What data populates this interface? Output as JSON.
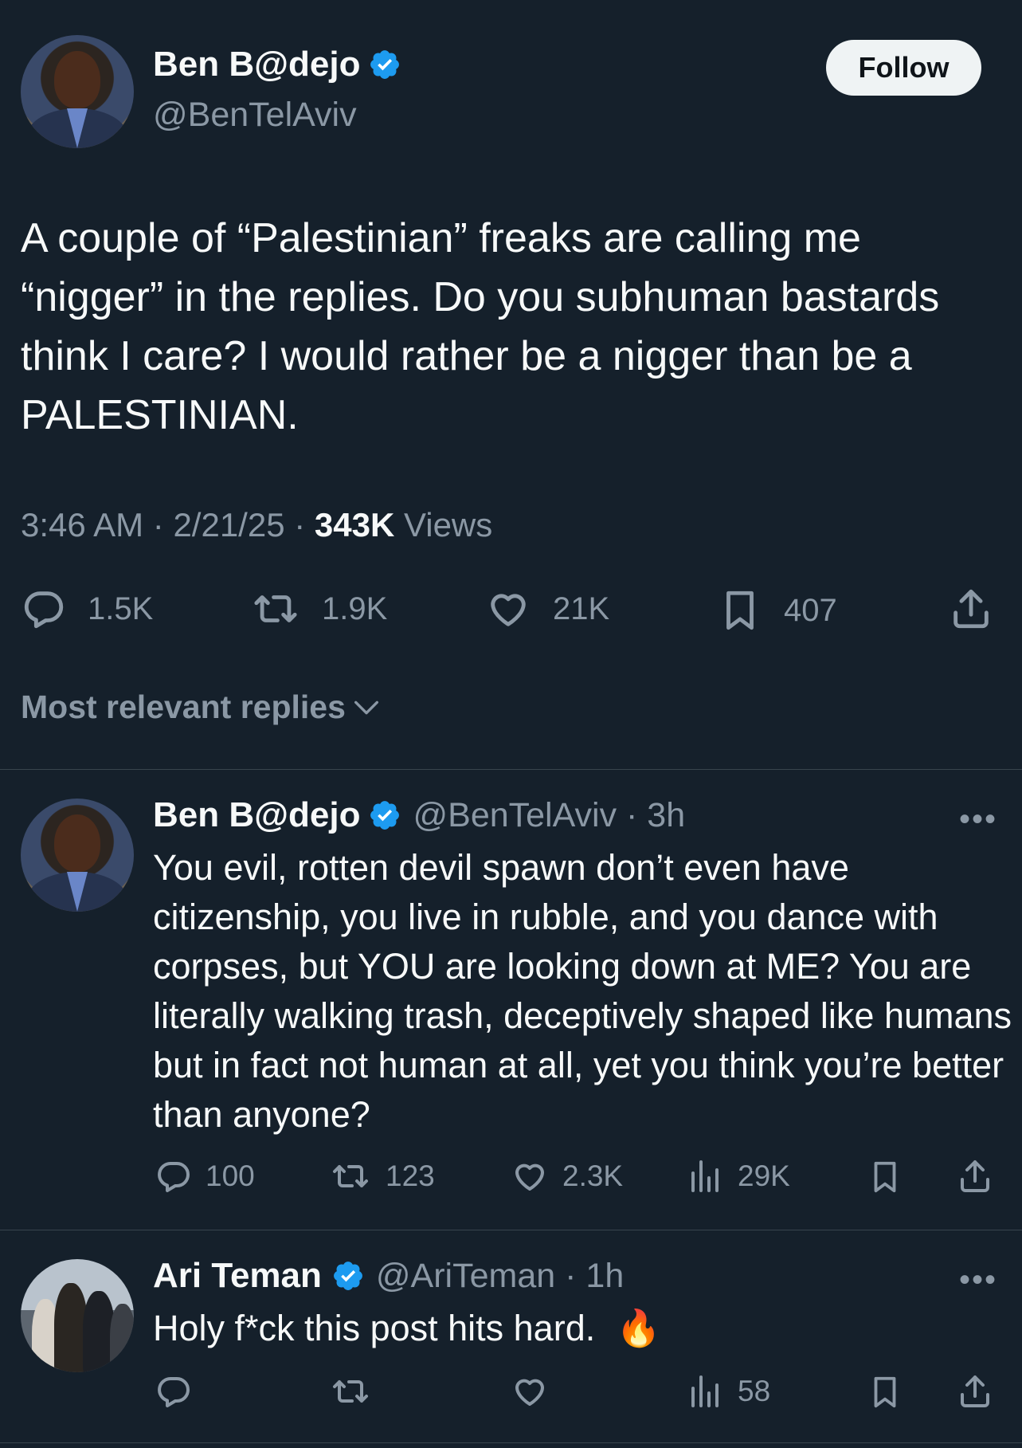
{
  "main_tweet": {
    "author_name": "Ben B@dejo",
    "author_handle": "@BenTelAviv",
    "follow_label": "Follow",
    "text": "A couple of “Palestinian” freaks are calling me “nigger” in the replies. Do you subhuman bastards think I care? I would rather be a nigger than be a PALESTINIAN.",
    "time": "3:46 AM",
    "date": "2/21/25",
    "views_count": "343K",
    "views_label": "Views",
    "replies": "1.5K",
    "reposts": "1.9K",
    "likes": "21K",
    "bookmarks": "407"
  },
  "sort_label": "Most relevant replies",
  "replies": [
    {
      "author_name": "Ben B@dejo",
      "author_handle": "@BenTelAviv",
      "age": "3h",
      "text": "You evil, rotten devil spawn don’t even have citizenship, you live in rubble, and you dance with corpses, but YOU are looking down at ME? You are literally walking trash, deceptively shaped like humans but in fact not human at all, yet you think you’re better than anyone?",
      "replies": "100",
      "reposts": "123",
      "likes": "2.3K",
      "views": "29K"
    },
    {
      "author_name": "Ari Teman",
      "author_handle": "@AriTeman",
      "age": "1h",
      "text": "Holy f*ck this post hits hard.",
      "emoji": "🔥",
      "views": "58"
    }
  ],
  "colors": {
    "background": "#15202b",
    "verified_blue": "#1d9bf0",
    "muted": "#8b98a5",
    "text": "#f7f9f9"
  }
}
